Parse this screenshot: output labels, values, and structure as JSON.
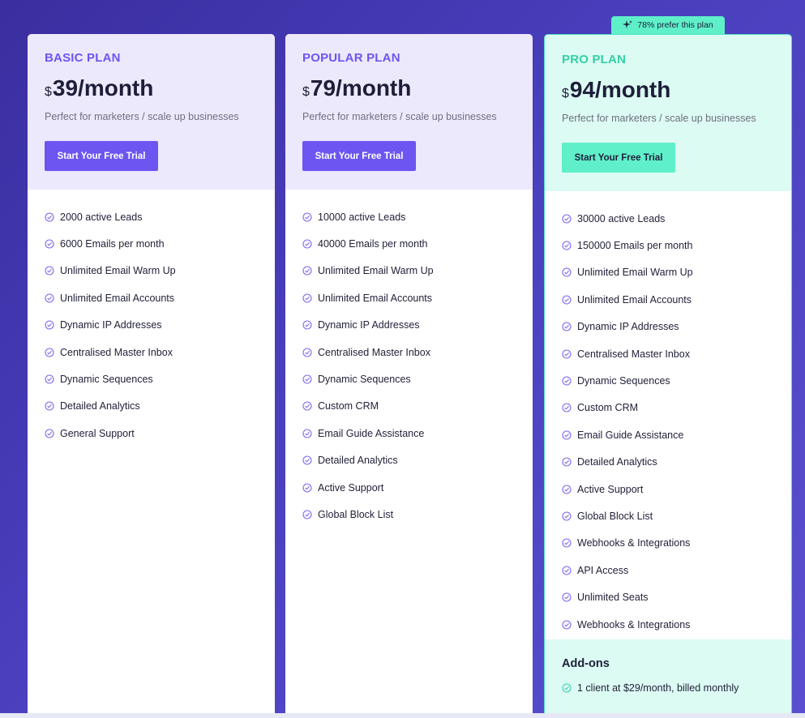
{
  "badge": {
    "text": "78% prefer this plan",
    "icon": "sparkle-icon"
  },
  "plans": [
    {
      "name": "BASIC PLAN",
      "currency": "$",
      "price": "39/month",
      "description": "Perfect for marketers / scale up businesses",
      "cta": "Start Your Free Trial",
      "features": [
        "2000 active Leads",
        "6000 Emails per month",
        "Unlimited Email Warm Up",
        "Unlimited Email Accounts",
        "Dynamic IP Addresses",
        "Centralised Master Inbox",
        "Dynamic Sequences",
        "Detailed Analytics",
        "General Support"
      ]
    },
    {
      "name": "POPULAR PLAN",
      "currency": "$",
      "price": "79/month",
      "description": "Perfect for marketers / scale up businesses",
      "cta": "Start Your Free Trial",
      "features": [
        "10000 active Leads",
        "40000 Emails per month",
        "Unlimited Email Warm Up",
        "Unlimited Email Accounts",
        "Dynamic IP Addresses",
        "Centralised Master Inbox",
        "Dynamic Sequences",
        "Custom CRM",
        "Email Guide Assistance",
        "Detailed Analytics",
        "Active Support",
        "Global Block List"
      ]
    },
    {
      "name": "PRO PLAN",
      "currency": "$",
      "price": "94/month",
      "description": "Perfect for marketers / scale up businesses",
      "cta": "Start Your Free Trial",
      "features": [
        "30000 active Leads",
        "150000 Emails per month",
        "Unlimited Email Warm Up",
        "Unlimited Email Accounts",
        "Dynamic IP Addresses",
        "Centralised Master Inbox",
        "Dynamic Sequences",
        "Custom CRM",
        "Email Guide Assistance",
        "Detailed Analytics",
        "Active Support",
        "Global Block List",
        "Webhooks & Integrations",
        "API Access",
        "Unlimited Seats",
        "Webhooks & Integrations"
      ],
      "addons": {
        "title": "Add-ons",
        "items": [
          "1 client at $29/month, billed monthly"
        ]
      }
    }
  ],
  "colors": {
    "background": "#4a3fbd",
    "accent": "#6c55f0",
    "pro_accent": "#5ff0c9",
    "check_purple": "#7b6af0",
    "check_teal": "#3ccfae"
  }
}
